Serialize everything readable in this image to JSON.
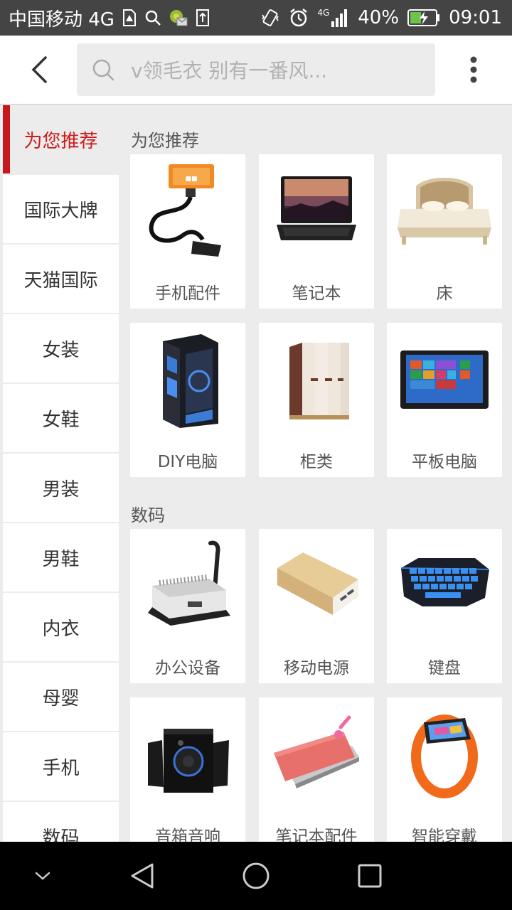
{
  "status_bar": {
    "carrier": "中国移动 4G",
    "network": "4G",
    "battery": "40%",
    "time": "09:01"
  },
  "search": {
    "placeholder": "v领毛衣 别有一番风..."
  },
  "sidebar": {
    "items": [
      {
        "label": "为您推荐",
        "active": true
      },
      {
        "label": "国际大牌"
      },
      {
        "label": "天猫国际"
      },
      {
        "label": "女装"
      },
      {
        "label": "女鞋"
      },
      {
        "label": "男装"
      },
      {
        "label": "男鞋"
      },
      {
        "label": "内衣"
      },
      {
        "label": "母婴"
      },
      {
        "label": "手机"
      },
      {
        "label": "数码"
      }
    ]
  },
  "sections": [
    {
      "title": "为您推荐",
      "items": [
        {
          "label": "手机配件",
          "icon": "phone-holder-icon"
        },
        {
          "label": "笔记本",
          "icon": "laptop-icon"
        },
        {
          "label": "床",
          "icon": "bed-icon"
        },
        {
          "label": "DIY电脑",
          "icon": "pc-case-icon"
        },
        {
          "label": "柜类",
          "icon": "wardrobe-icon"
        },
        {
          "label": "平板电脑",
          "icon": "tablet-icon"
        }
      ]
    },
    {
      "title": "数码",
      "items": [
        {
          "label": "办公设备",
          "icon": "binding-machine-icon"
        },
        {
          "label": "移动电源",
          "icon": "power-bank-icon"
        },
        {
          "label": "键盘",
          "icon": "keyboard-icon"
        },
        {
          "label": "音箱音响",
          "icon": "speaker-icon"
        },
        {
          "label": "笔记本配件",
          "icon": "laptop-sleeve-icon"
        },
        {
          "label": "智能穿戴",
          "icon": "smart-band-icon"
        }
      ]
    }
  ],
  "colors": {
    "accent": "#c8161d",
    "background": "#ececec",
    "status_bar": "#444444"
  }
}
